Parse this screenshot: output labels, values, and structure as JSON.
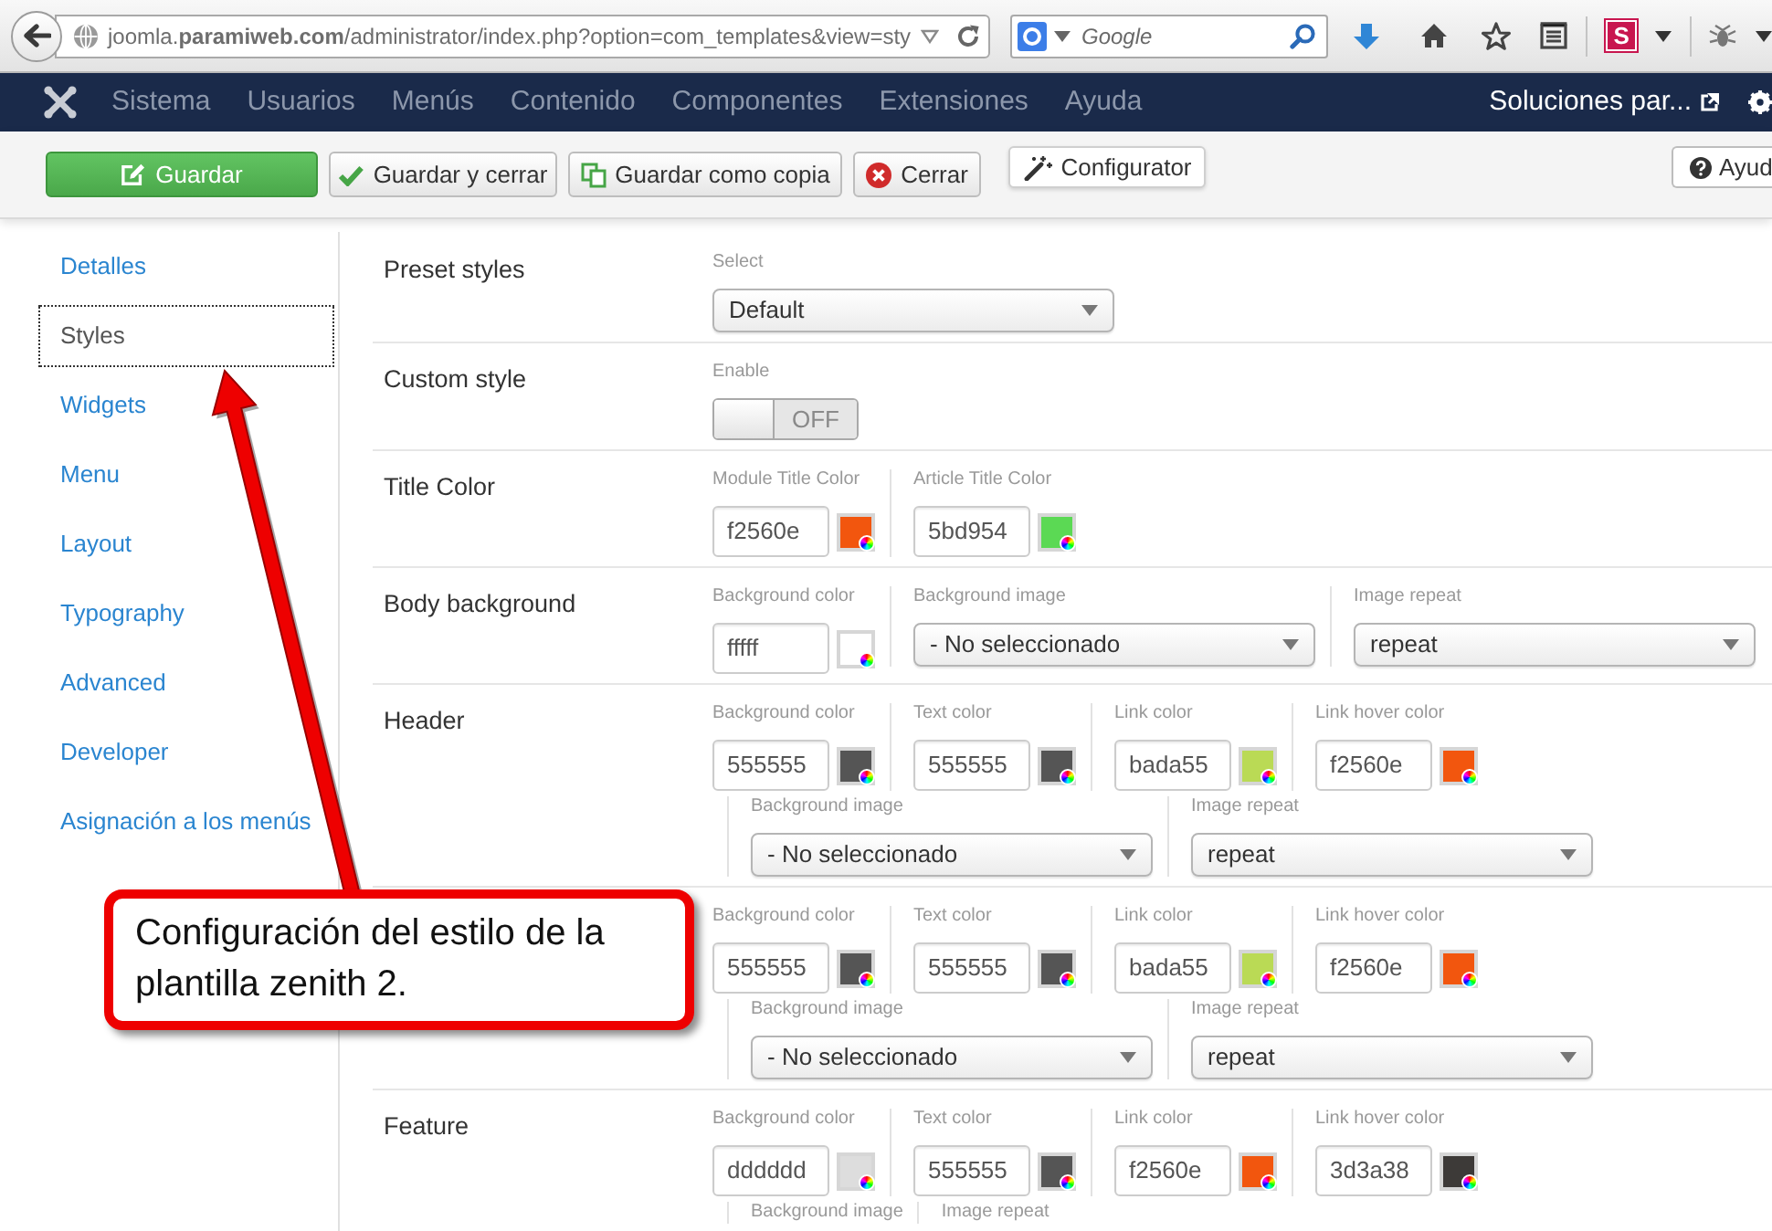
{
  "browser": {
    "url": "joomla.**paramiweb.com**/administrator/index.php?option=com_templates&view=sty",
    "search": {
      "placeholder": "Google"
    },
    "extension_label": "S"
  },
  "nav": {
    "menu": [
      "Sistema",
      "Usuarios",
      "Menús",
      "Contenido",
      "Componentes",
      "Extensiones",
      "Ayuda"
    ],
    "site_link": "Soluciones par..."
  },
  "toolbar": {
    "buttons": [
      {
        "kind": "save",
        "label": "Guardar"
      },
      {
        "kind": "save_close",
        "label": "Guardar y cerrar"
      },
      {
        "kind": "save_copy",
        "label": "Guardar como copia"
      },
      {
        "kind": "close",
        "label": "Cerrar"
      },
      {
        "kind": "configurator",
        "label": "Configurator"
      }
    ],
    "help": "Ayud"
  },
  "sidebar": {
    "items": [
      {
        "label": "Detalles",
        "selected": false
      },
      {
        "label": "Styles",
        "selected": true
      },
      {
        "label": "Widgets",
        "selected": false
      },
      {
        "label": "Menu",
        "selected": false
      },
      {
        "label": "Layout",
        "selected": false
      },
      {
        "label": "Typography",
        "selected": false
      },
      {
        "label": "Advanced",
        "selected": false
      },
      {
        "label": "Developer",
        "selected": false
      },
      {
        "label": "Asignación a los menús",
        "selected": false
      }
    ]
  },
  "rows": [
    {
      "label": "Preset styles",
      "lines": [
        [
          {
            "kind": "select",
            "label": "Select",
            "value": "Default"
          }
        ]
      ]
    },
    {
      "label": "Custom style",
      "lines": [
        [
          {
            "kind": "toggle",
            "label": "Enable",
            "on": false,
            "text": "OFF"
          }
        ]
      ]
    },
    {
      "label": "Title Color",
      "lines": [
        [
          {
            "kind": "color",
            "label": "Module Title Color",
            "value": "f2560e",
            "color": "#f2560e"
          },
          {
            "kind": "color",
            "label": "Article Title Color",
            "value": "5bd954",
            "color": "#5bd954"
          }
        ]
      ]
    },
    {
      "label": "Body background",
      "lines": [
        [
          {
            "kind": "color",
            "label": "Background color",
            "value": "fffff",
            "color": "#ffffff"
          },
          {
            "kind": "select",
            "label": "Background image",
            "value": "- No seleccionado"
          },
          {
            "kind": "select",
            "label": "Image repeat",
            "value": "repeat"
          }
        ]
      ]
    },
    {
      "label": "Header",
      "lines": [
        [
          {
            "kind": "color",
            "label": "Background color",
            "value": "555555",
            "color": "#555555"
          },
          {
            "kind": "color",
            "label": "Text color",
            "value": "555555",
            "color": "#555555"
          },
          {
            "kind": "color",
            "label": "Link color",
            "value": "bada55",
            "color": "#bada55"
          },
          {
            "kind": "color",
            "label": "Link hover color",
            "value": "f2560e",
            "color": "#f2560e"
          }
        ],
        [
          {
            "kind": "select",
            "label": "Background image",
            "value": "- No seleccionado"
          },
          {
            "kind": "select",
            "label": "Image repeat",
            "value": "repeat"
          }
        ]
      ]
    },
    {
      "lines": [
        [
          {
            "kind": "color",
            "label": "Background color",
            "value": "555555",
            "color": "#555555"
          },
          {
            "kind": "color",
            "label": "Text color",
            "value": "555555",
            "color": "#555555"
          },
          {
            "kind": "color",
            "label": "Link color",
            "value": "bada55",
            "color": "#bada55"
          },
          {
            "kind": "color",
            "label": "Link hover color",
            "value": "f2560e",
            "color": "#f2560e"
          }
        ],
        [
          {
            "kind": "select",
            "label": "Background image",
            "value": "- No seleccionado"
          },
          {
            "kind": "select",
            "label": "Image repeat",
            "value": "repeat"
          }
        ]
      ]
    },
    {
      "label": "Feature",
      "lines": [
        [
          {
            "kind": "color",
            "label": "Background color",
            "value": "dddddd",
            "color": "#dddddd"
          },
          {
            "kind": "color",
            "label": "Text color",
            "value": "555555",
            "color": "#555555"
          },
          {
            "kind": "color",
            "label": "Link color",
            "value": "f2560e",
            "color": "#f2560e"
          },
          {
            "kind": "color",
            "label": "Link hover color",
            "value": "3d3a38",
            "color": "#3d3a38"
          }
        ],
        [
          {
            "kind": "select",
            "label": "Background image"
          },
          {
            "kind": "select",
            "label": "Image repeat"
          }
        ]
      ]
    }
  ],
  "callout": {
    "text": "Configuración del estilo de la plantilla zenith 2."
  }
}
